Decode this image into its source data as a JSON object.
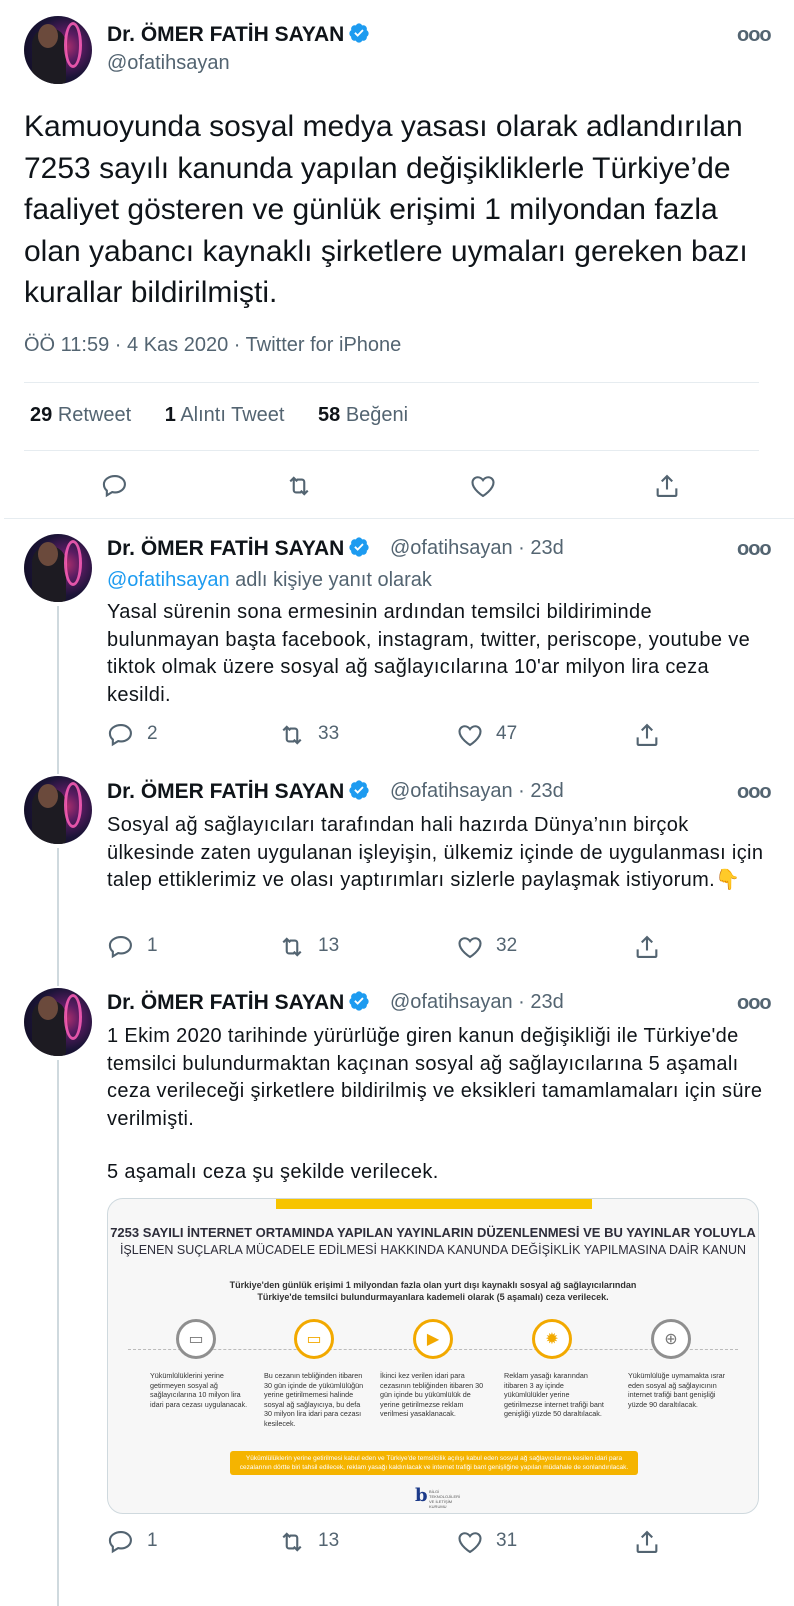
{
  "author": {
    "name": "Dr. ÖMER FATİH SAYAN",
    "handle": "@ofatihsayan"
  },
  "icons": {
    "verified": "verified-badge-icon",
    "more": "more-icon",
    "reply": "reply-icon",
    "retweet": "retweet-icon",
    "like": "like-icon",
    "share": "share-icon"
  },
  "colors": {
    "link": "#1d9bf0",
    "muted": "#536471",
    "accent_yellow": "#f5b400"
  },
  "main_tweet": {
    "text": "Kamuoyunda sosyal medya yasası olarak adlandırılan 7253 sayılı kanunda yapılan değişikliklerle Türkiye’de faaliyet gösteren ve günlük erişimi 1 milyondan fazla olan yabancı kaynaklı şirketlere uymaları gereken bazı kurallar bildirilmişti.",
    "time": "ÖÖ 11:59",
    "date": "4 Kas 2020",
    "source": "Twitter for iPhone",
    "separator": "·",
    "stats": {
      "retweets": "29",
      "retweets_label": "Retweet",
      "quotes": "1",
      "quotes_label": "Alıntı Tweet",
      "likes": "58",
      "likes_label": "Beğeni"
    }
  },
  "replies": [
    {
      "meta": "@ofatihsayan · 23d",
      "reply_prefix": "@ofatihsayan",
      "reply_suffix": " adlı kişiye yanıt olarak",
      "text": "Yasal sürenin sona ermesinin ardından temsilci bildiriminde bulunmayan başta facebook, instagram, twitter, periscope, youtube ve tiktok olmak üzere sosyal ağ sağlayıcılarına 10'ar milyon lira ceza kesildi.",
      "replies": "2",
      "retweets": "33",
      "likes": "47"
    },
    {
      "meta": "@ofatihsayan · 23d",
      "text": "Sosyal ağ sağlayıcıları tarafından hali hazırda Dünya’nın birçok ülkesinde zaten uygulanan işleyişin, ülkemiz içinde de uygulanması için talep ettiklerimiz ve olası yaptırımları sizlerle paylaşmak istiyorum.👇",
      "replies": "1",
      "retweets": "13",
      "likes": "32"
    },
    {
      "meta": "@ofatihsayan · 23d",
      "text": "1 Ekim 2020 tarihinde yürürlüğe giren kanun değişikliği ile Türkiye'de temsilci bulundurmaktan kaçınan sosyal ağ sağlayıcılarına 5 aşamalı ceza verileceği şirketlere bildirilmiş ve eksikleri tamamlamaları için süre verilmişti.",
      "text2": "5 aşamalı ceza şu şekilde verilecek.",
      "replies": "1",
      "retweets": "13",
      "likes": "31"
    }
  ],
  "infographic": {
    "title1": "7253 SAYILI İNTERNET ORTAMINDA YAPILAN YAYINLARIN DÜZENLENMESİ VE BU YAYINLAR YOLUYLA",
    "title2": "İŞLENEN SUÇLARLA MÜCADELE EDİLMESİ HAKKINDA KANUNDA DEĞİŞİKLİK YAPILMASINA DAİR KANUN",
    "subtitle1": "Türkiye'den günlük erişimi 1 milyondan fazla olan yurt dışı kaynaklı sosyal ağ sağlayıcılarından",
    "subtitle2": "Türkiye'de temsilci bulundurmayanlara kademeli olarak (5 aşamalı) ceza verilecek.",
    "steps": [
      {
        "icon": "card-icon",
        "text": "Yükümlülüklerini yerine getirmeyen sosyal ağ sağlayıcılarına 10 milyon lira idari para cezası uygulanacak."
      },
      {
        "icon": "money-icon",
        "text": "Bu cezanın tebliğinden itibaren 30 gün içinde de yükümlülüğün yerine getirilmemesi halinde sosyal ağ sağlayıcıya, bu defa 30 milyon lira idari para cezası kesilecek."
      },
      {
        "icon": "play-icon",
        "text": "İkinci kez verilen idari para cezasının tebliğinden itibaren 30 gün içinde bu yükümlülük de yerine getirilmezse reklam verilmesi yasaklanacak."
      },
      {
        "icon": "sun-icon",
        "text": "Reklam yasağı kararından itibaren 3 ay içinde yükümlülükler yerine getirilmezse internet trafiği bant genişliği yüzde 50 daraltılacak."
      },
      {
        "icon": "antenna-icon",
        "text": "Yükümlülüğe uymamakta ısrar eden sosyal ağ sağlayıcının internet trafiği bant genişliği yüzde 90 daraltılacak."
      }
    ],
    "banner": "Yükümlülüklerin yerine getirilmesi kabul eden ve Türkiye'de temsilcilik açılışı kabul eden sosyal ağ sağlayıcılarına kesilen idari para cezalarının dörtte biri tahsil edilecek, reklam yasağı kaldırılacak ve internet trafiği bant genişliğine yapılan müdahale de sonlandırılacak.",
    "logo_letter": "b",
    "logo_text": "BİLGİ TEKNOLOJİLERİ VE İLETİŞİM KURUMU"
  }
}
